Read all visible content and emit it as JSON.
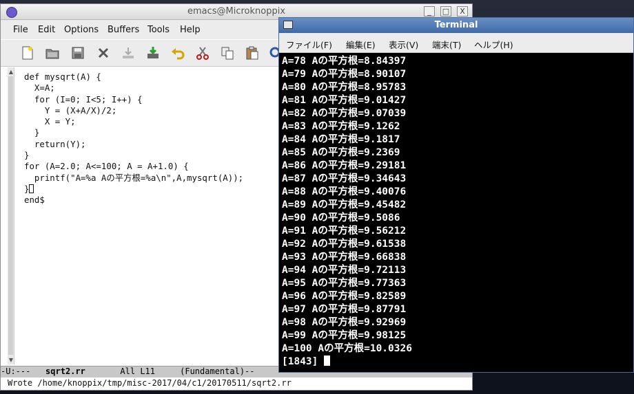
{
  "emacs": {
    "title": "emacs@Microknoppix",
    "window_buttons": [
      "_",
      "□",
      "X"
    ],
    "menu": [
      "File",
      "Edit",
      "Options",
      "Buffers",
      "Tools",
      "Help"
    ],
    "toolbar_icons": [
      "new-file-icon",
      "open-folder-icon",
      "save-icon",
      "close-x-icon",
      "save-down-icon",
      "save-as-icon",
      "undo-icon",
      "cut-scissors-icon",
      "copy-icon",
      "paste-icon",
      "search-icon"
    ],
    "code_lines": [
      "def mysqrt(A) {",
      "  X=A;",
      "  for (I=0; I<5; I++) {",
      "    Y = (X+A/X)/2;",
      "    X = Y;",
      "  }",
      "  return(Y);",
      "}",
      "for (A=2.0; A<=100; A = A+1.0) {",
      "  printf(\"A=%a Aの平方根=%a\\n\",A,mysqrt(A));",
      "}",
      "end$"
    ],
    "modeline": {
      "status": "-U:---",
      "buffer": "sqrt2.rr",
      "position": "All L11",
      "mode": "(Fundamental)--"
    },
    "echo": "Wrote /home/knoppix/tmp/misc-2017/04/c1/20170511/sqrt2.rr"
  },
  "terminal": {
    "title": "Terminal",
    "menu": [
      "ファイル(F)",
      "編集(E)",
      "表示(V)",
      "端末(T)",
      "ヘルプ(H)"
    ],
    "lines": [
      "A=78 Aの平方根=8.84397",
      "A=79 Aの平方根=8.90107",
      "A=80 Aの平方根=8.95783",
      "A=81 Aの平方根=9.01427",
      "A=82 Aの平方根=9.07039",
      "A=83 Aの平方根=9.1262",
      "A=84 Aの平方根=9.1817",
      "A=85 Aの平方根=9.2369",
      "A=86 Aの平方根=9.29181",
      "A=87 Aの平方根=9.34643",
      "A=88 Aの平方根=9.40076",
      "A=89 Aの平方根=9.45482",
      "A=90 Aの平方根=9.5086",
      "A=91 Aの平方根=9.56212",
      "A=92 Aの平方根=9.61538",
      "A=93 Aの平方根=9.66838",
      "A=94 Aの平方根=9.72113",
      "A=95 Aの平方根=9.77363",
      "A=96 Aの平方根=9.82589",
      "A=97 Aの平方根=9.87791",
      "A=98 Aの平方根=9.92969",
      "A=99 Aの平方根=9.98125",
      "A=100 Aの平方根=10.0326"
    ],
    "prompt": "[1843]"
  },
  "colors": {
    "terminal_titlebar": "#4a74b0",
    "terminal_bg": "#000000",
    "terminal_fg": "#ffffff",
    "emacs_modeline": "#c8c8c8"
  }
}
